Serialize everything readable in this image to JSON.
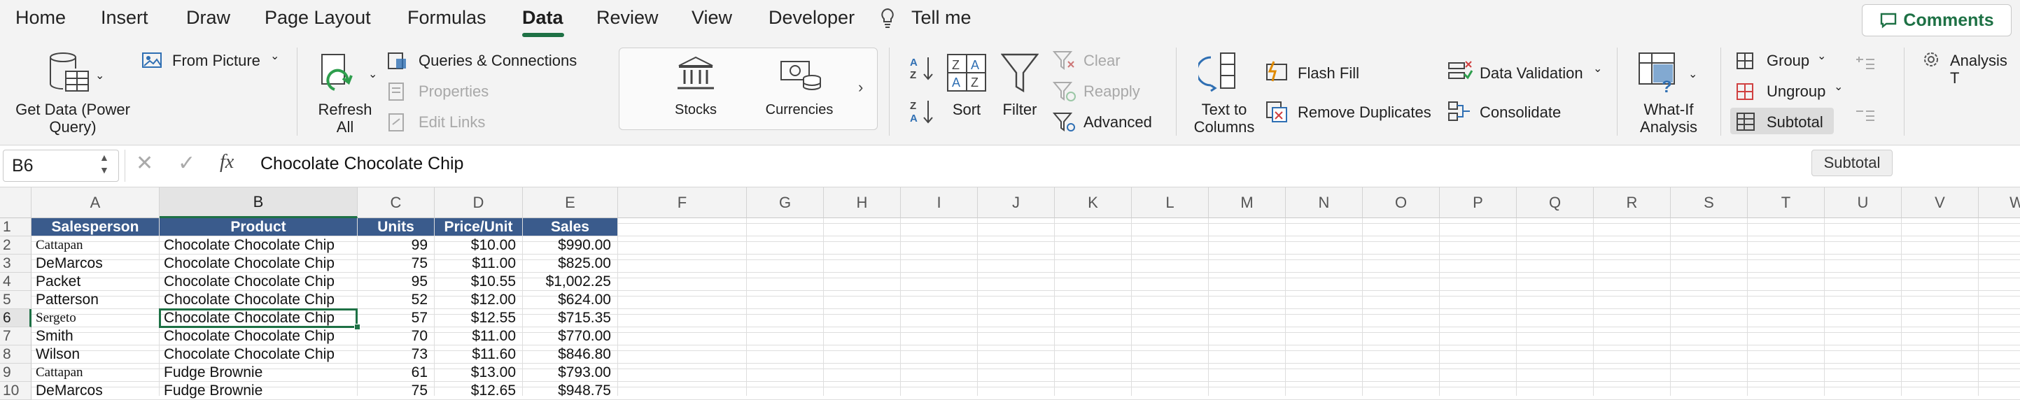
{
  "menu": {
    "tabs": [
      "Home",
      "Insert",
      "Draw",
      "Page Layout",
      "Formulas",
      "Data",
      "Review",
      "View",
      "Developer",
      "Tell me"
    ],
    "active_tab": "Data",
    "comments_label": "Comments"
  },
  "ribbon": {
    "get_data": "Get Data (Power Query)",
    "from_picture": "From Picture",
    "refresh_all": "Refresh All",
    "queries_connections": "Queries & Connections",
    "properties": "Properties",
    "edit_links": "Edit Links",
    "stocks": "Stocks",
    "currencies": "Currencies",
    "sort": "Sort",
    "filter": "Filter",
    "clear": "Clear",
    "reapply": "Reapply",
    "advanced": "Advanced",
    "text_to_columns": "Text to Columns",
    "flash_fill": "Flash Fill",
    "remove_duplicates": "Remove Duplicates",
    "data_validation": "Data Validation",
    "consolidate": "Consolidate",
    "what_if": "What-If Analysis",
    "group": "Group",
    "ungroup": "Ungroup",
    "subtotal": "Subtotal",
    "analysis_tools": "Analysis T"
  },
  "formula_bar": {
    "name_box": "B6",
    "fx": "fx",
    "formula": "Chocolate Chocolate Chip",
    "tooltip": "Subtotal"
  },
  "grid": {
    "columns": [
      "A",
      "B",
      "C",
      "D",
      "E",
      "F",
      "G",
      "H",
      "I",
      "J",
      "K",
      "L",
      "M",
      "N",
      "O",
      "P",
      "Q",
      "R",
      "S",
      "T",
      "U",
      "V",
      "W"
    ],
    "selected_column": "B",
    "selected_row": "6",
    "row_numbers": [
      "1",
      "2",
      "3",
      "4",
      "5",
      "6",
      "7",
      "8",
      "9",
      "10"
    ],
    "headers": [
      "Salesperson",
      "Product",
      "Units",
      "Price/Unit",
      "Sales"
    ],
    "rows": [
      [
        "Cattapan",
        "Chocolate Chocolate Chip",
        "99",
        "$10.00",
        "$990.00"
      ],
      [
        "DeMarcos",
        "Chocolate Chocolate Chip",
        "75",
        "$11.00",
        "$825.00"
      ],
      [
        "Packet",
        "Chocolate Chocolate Chip",
        "95",
        "$10.55",
        "$1,002.25"
      ],
      [
        "Patterson",
        "Chocolate Chocolate Chip",
        "52",
        "$12.00",
        "$624.00"
      ],
      [
        "Sergeto",
        "Chocolate Chocolate Chip",
        "57",
        "$12.55",
        "$715.35"
      ],
      [
        "Smith",
        "Chocolate Chocolate Chip",
        "70",
        "$11.00",
        "$770.00"
      ],
      [
        "Wilson",
        "Chocolate Chocolate Chip",
        "73",
        "$11.60",
        "$846.80"
      ],
      [
        "Cattapan",
        "Fudge Brownie",
        "61",
        "$13.00",
        "$793.00"
      ],
      [
        "DeMarcos",
        "Fudge Brownie",
        "75",
        "$12.65",
        "$948.75"
      ]
    ],
    "header_fill": "#3a5b8c",
    "selection_color": "#1e7145"
  }
}
